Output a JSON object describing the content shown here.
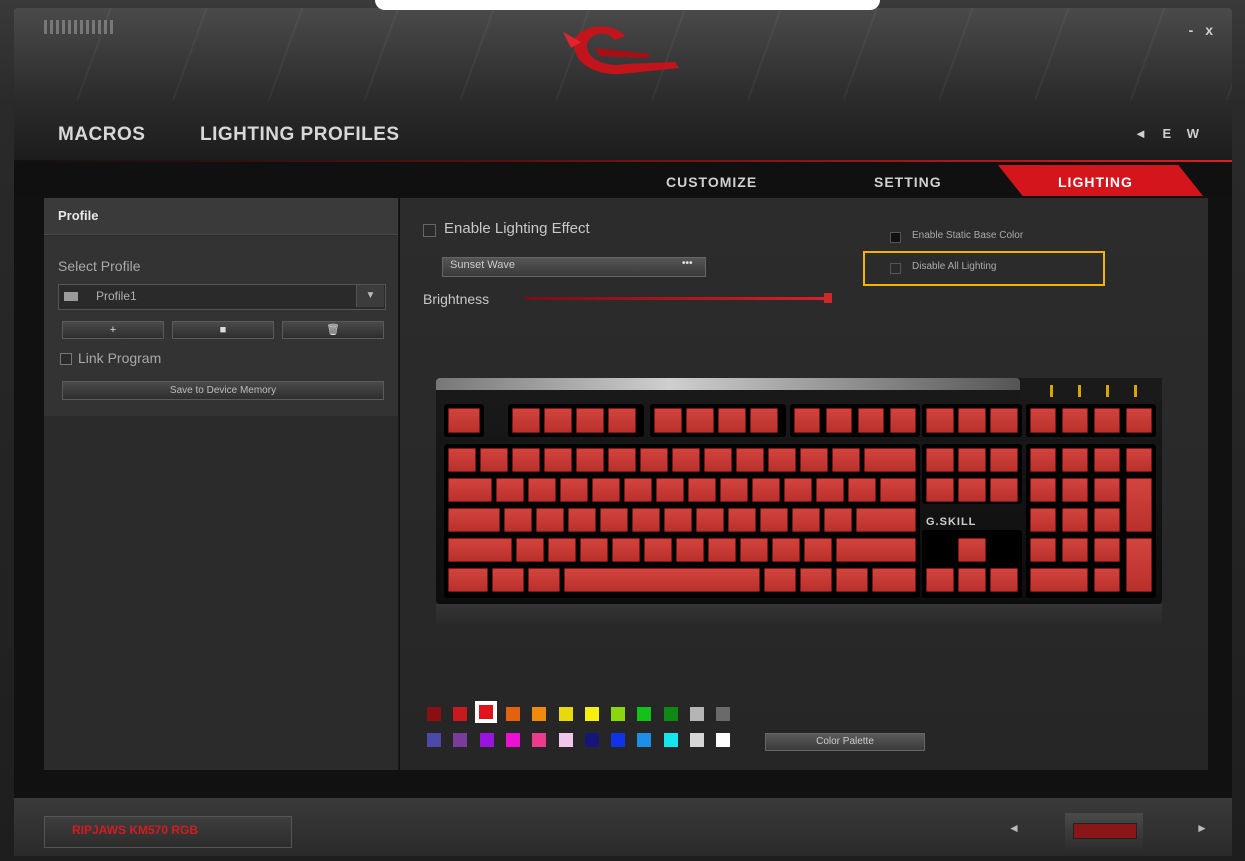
{
  "window": {
    "controls": "- x"
  },
  "nav": {
    "macros": "MACROS",
    "lighting_profiles": "LIGHTING PROFILES",
    "icons": "◄ E W"
  },
  "tabs": {
    "customize": "CUSTOMIZE",
    "setting": "SETTING",
    "lighting": "LIGHTING"
  },
  "profile": {
    "title": "Profile",
    "select_label": "Select Profile",
    "selected": "Profile1",
    "add": "+",
    "remove": "■",
    "delete": "🗑",
    "link_program": "Link Program",
    "save_button": "Save to Device Memory"
  },
  "lighting": {
    "enable_label": "Enable Lighting Effect",
    "effect_value": "Sunset Wave",
    "effect_more": "•••",
    "brightness_label": "Brightness",
    "brightness_level": 1.0,
    "static_base_color": "Enable Static Base Color",
    "disable_all": "Disable All Lighting"
  },
  "keyboard": {
    "brand_logo": "G.SKILL",
    "key_color": "#c8373a"
  },
  "palette": {
    "button": "Color Palette",
    "row1": [
      "#8b0f12",
      "#c8191f",
      "#e0121a",
      "#e26210",
      "#f08a0e",
      "#e7d90a",
      "#f4ef0c",
      "#8bd60c",
      "#12c21a",
      "#0e8a14",
      "#b5b5b5",
      "#6a6a6a"
    ],
    "row2": [
      "#4b4aa8",
      "#7b3b9a",
      "#9a14e0",
      "#ec10d2",
      "#ec3a8c",
      "#f0c6e8",
      "#15157a",
      "#1032e8",
      "#1e8ee8",
      "#14e6ee",
      "#d6d6d6",
      "#ffffff"
    ],
    "selected_index": 2
  },
  "footer": {
    "model": "RIPJAWS KM570 RGB",
    "prev": "◄",
    "next": "►"
  }
}
